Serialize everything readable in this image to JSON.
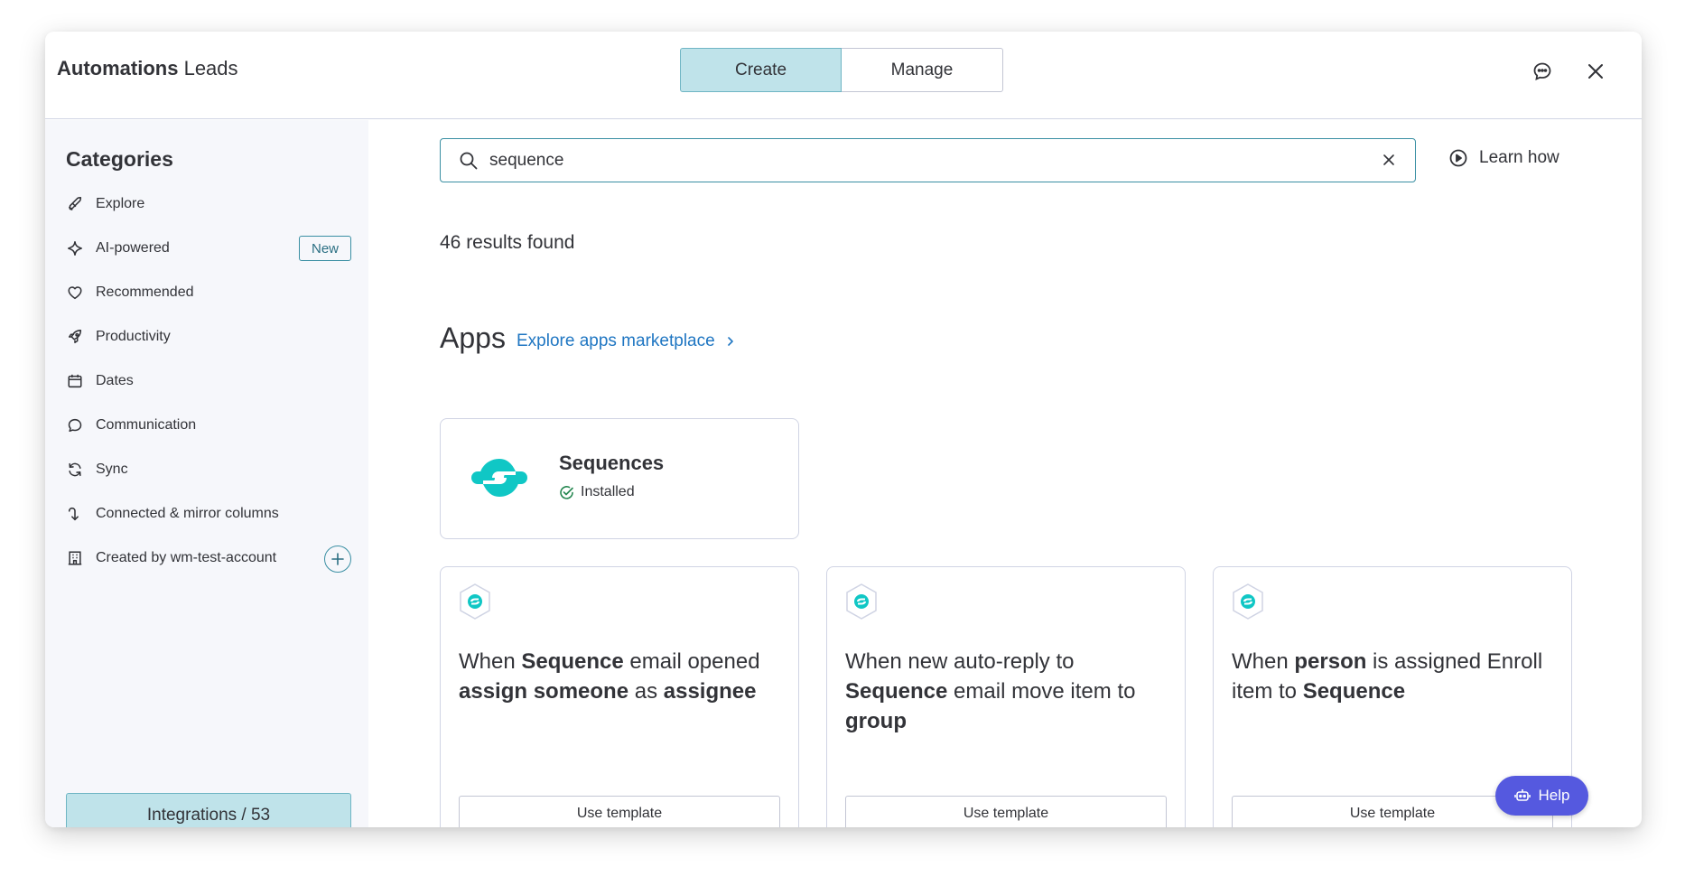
{
  "header": {
    "title_bold": "Automations",
    "title_board": "Leads",
    "tabs": [
      {
        "label": "Create",
        "active": true
      },
      {
        "label": "Manage",
        "active": false
      }
    ],
    "feedback_icon": "chat-bubble-icon",
    "close_icon": "close-icon"
  },
  "sidebar": {
    "title": "Categories",
    "items": [
      {
        "label": "Explore",
        "icon": "rocket-icon"
      },
      {
        "label": "AI-powered",
        "icon": "sparkle-icon",
        "badge": "New"
      },
      {
        "label": "Recommended",
        "icon": "heart-icon"
      },
      {
        "label": "Productivity",
        "icon": "rocket-launch-icon"
      },
      {
        "label": "Dates",
        "icon": "calendar-icon"
      },
      {
        "label": "Communication",
        "icon": "speech-bubble-icon"
      },
      {
        "label": "Sync",
        "icon": "sync-icon"
      },
      {
        "label": "Connected & mirror columns",
        "icon": "connect-arrow-icon"
      },
      {
        "label": "Created by wm-test-account",
        "icon": "building-icon"
      }
    ],
    "integrations_label": "Integrations / 53",
    "integration_icons": [
      "outlook-icon",
      "gmail-icon",
      "slack-icon",
      "google-calendar-icon"
    ]
  },
  "search": {
    "value": "sequence",
    "placeholder": "Search"
  },
  "learn_how": "Learn how",
  "results_text": "46 results found",
  "apps": {
    "title": "Apps",
    "link": "Explore apps marketplace"
  },
  "app_card": {
    "name": "Sequences",
    "status": "Installed"
  },
  "templates": [
    {
      "parts": [
        {
          "t": "When ",
          "b": false
        },
        {
          "t": "Sequence",
          "b": true
        },
        {
          "t": " email opened ",
          "b": false
        },
        {
          "t": "assign someone",
          "b": true
        },
        {
          "t": " as ",
          "b": false
        },
        {
          "t": "assignee",
          "b": true
        }
      ],
      "button": "Use template"
    },
    {
      "parts": [
        {
          "t": "When new auto-reply to ",
          "b": false
        },
        {
          "t": "Sequence",
          "b": true
        },
        {
          "t": " email move item to ",
          "b": false
        },
        {
          "t": "group",
          "b": true
        }
      ],
      "button": "Use template"
    },
    {
      "parts": [
        {
          "t": "When ",
          "b": false
        },
        {
          "t": "person",
          "b": true
        },
        {
          "t": " is assigned Enroll item to ",
          "b": false
        },
        {
          "t": "Sequence",
          "b": true
        }
      ],
      "button": "Use template"
    }
  ],
  "help": "Help",
  "colors": {
    "accent": "#bfe3ea",
    "accent_border": "#3a8fa3",
    "link": "#1f76c2",
    "sequence_teal": "#10c7c5",
    "help_button": "#5559df"
  }
}
